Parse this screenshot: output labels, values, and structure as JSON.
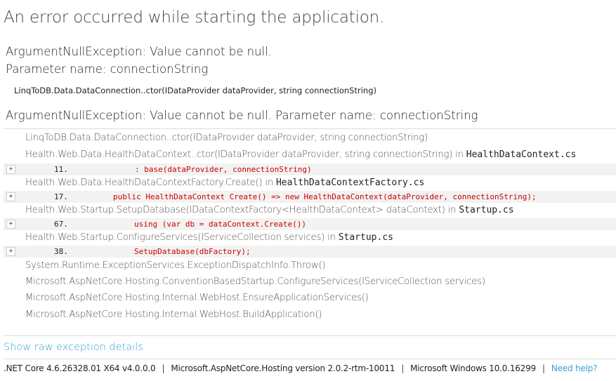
{
  "page": {
    "title": "An error occurred while starting the application."
  },
  "summary": {
    "message_line1": "ArgumentNullException: Value cannot be null.",
    "message_line2": "Parameter name: connectionString",
    "frame": "LinqToDB.Data.DataConnection..ctor(IDataProvider dataProvider, string connectionString)"
  },
  "exception": {
    "header": "ArgumentNullException: Value cannot be null. Parameter name: connectionString",
    "frames": [
      {
        "method": "LinqToDB.Data.DataConnection..ctor(IDataProvider dataProvider, string connectionString)"
      },
      {
        "method": "Health.Web.Data.HealthDataContext..ctor(IDataProvider dataProvider, string connectionString) in ",
        "file": "HealthDataContext.cs",
        "source": {
          "expand": "+",
          "line": "11.",
          "code": ": base(dataProvider, connectionString)"
        }
      },
      {
        "method": "Health.Web.Data.HealthDataContextFactory.Create() in ",
        "file": "HealthDataContextFactory.cs",
        "source": {
          "expand": "+",
          "line": "17.",
          "code": "public HealthDataContext Create() => new HealthDataContext(dataProvider, connectionString);"
        }
      },
      {
        "method": "Health.Web.Startup.SetupDatabase(IDataContextFactory<HealthDataContext> dataContext) in ",
        "file": "Startup.cs",
        "source": {
          "expand": "+",
          "line": "67.",
          "code": "using (var db = dataContext.Create())"
        }
      },
      {
        "method": "Health.Web.Startup.ConfigureServices(IServiceCollection services) in ",
        "file": "Startup.cs",
        "source": {
          "expand": "+",
          "line": "38.",
          "code": "SetupDatabase(dbFactory);"
        }
      },
      {
        "method": "System.Runtime.ExceptionServices.ExceptionDispatchInfo.Throw()"
      },
      {
        "method": "Microsoft.AspNetCore.Hosting.ConventionBasedStartup.ConfigureServices(IServiceCollection services)"
      },
      {
        "method": "Microsoft.AspNetCore.Hosting.Internal.WebHost.EnsureApplicationServices()"
      },
      {
        "method": "Microsoft.AspNetCore.Hosting.Internal.WebHost.BuildApplication()"
      }
    ]
  },
  "links": {
    "raw_exception": "Show raw exception details"
  },
  "footer": {
    "runtime": ".NET Core 4.6.26328.01 X64 v4.0.0.0",
    "separator": "|",
    "hosting": "Microsoft.AspNetCore.Hosting version 2.0.2-rtm-10011",
    "os": "Microsoft Windows 10.0.16299",
    "help": "Need help?"
  }
}
